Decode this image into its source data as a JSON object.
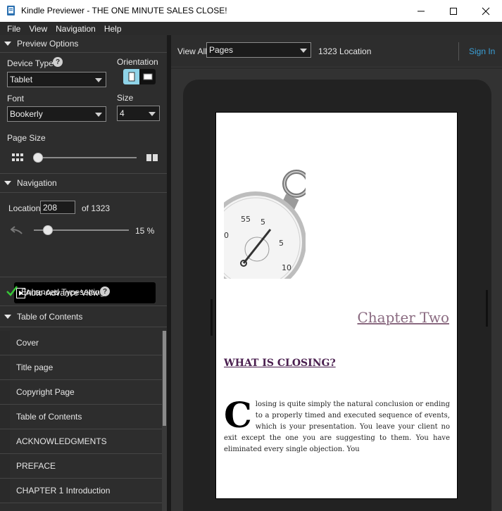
{
  "window": {
    "title": "Kindle Previewer - THE ONE MINUTE SALES CLOSE!"
  },
  "menu": [
    "File",
    "View",
    "Navigation",
    "Help"
  ],
  "preview_options": {
    "header": "Preview Options",
    "device_type_label": "Device Type",
    "device_type_value": "Tablet",
    "orientation_label": "Orientation",
    "font_label": "Font",
    "font_value": "Bookerly",
    "size_label": "Size",
    "size_value": "4",
    "page_size_label": "Page Size",
    "page_size_level": 0
  },
  "navigation": {
    "header": "Navigation",
    "location_label": "Location",
    "location_value": "208",
    "of_total": "of 1323",
    "progress_percent": 15,
    "progress_text": "15 %",
    "auto_advance_label": "Auto-Advance View"
  },
  "enhanced_typesetting_label": "Enhanced Typesetting",
  "toc": {
    "header": "Table of Contents",
    "items": [
      "Cover",
      "Title page",
      "Copyright Page",
      "Table of Contents",
      "ACKNOWLEDGMENTS",
      "PREFACE",
      "CHAPTER  1 Introduction"
    ]
  },
  "toolbar": {
    "view_all_label": "View All",
    "view_mode": "Pages",
    "location_count": "1323 Location",
    "sign_in": "Sign In"
  },
  "book": {
    "chapter_title": "Chapter Two",
    "section_heading": "WHAT IS CLOSING?",
    "dropcap": "C",
    "body_text": "losing is quite simply the natural conclusion or ending to a properly timed and executed sequence of events, which is your presentation. You leave your client no exit except the one you are suggesting to them. You have eliminated every single objection. You"
  },
  "colors": {
    "accent": "#3a9fd6",
    "check": "#37c837",
    "chapter": "#8a6a80",
    "heading": "#4a1f4f"
  }
}
